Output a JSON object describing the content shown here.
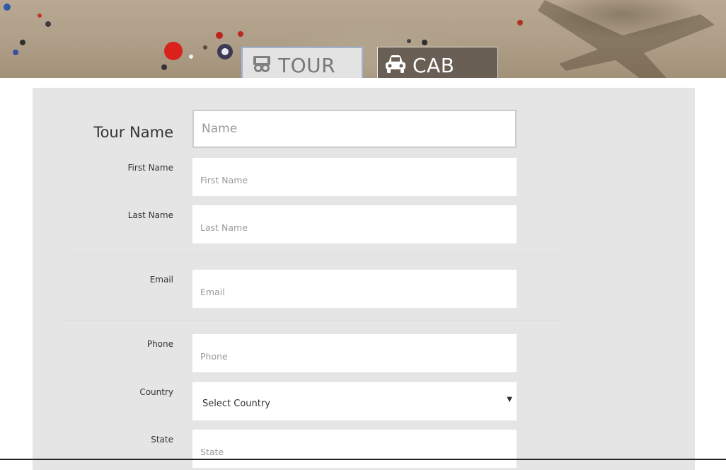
{
  "tabs": {
    "tour_label": "TOUR",
    "cab_label": "CAB"
  },
  "form": {
    "tour_name": {
      "label": "Tour Name",
      "placeholder": "Name"
    },
    "first_name": {
      "label": "First Name",
      "placeholder": "First Name"
    },
    "last_name": {
      "label": "Last Name",
      "placeholder": "Last Name"
    },
    "email": {
      "label": "Email",
      "placeholder": "Email"
    },
    "phone": {
      "label": "Phone",
      "placeholder": "Phone"
    },
    "country": {
      "label": "Country",
      "selected": "Select Country",
      "caret": "▼"
    },
    "state": {
      "label": "State",
      "placeholder": "State"
    }
  },
  "colors": {
    "card_bg": "#e5e5e5",
    "tab_tour_border": "#9db3d4",
    "tab_cab_bg": "#6a5f55"
  },
  "icons": {
    "tour": "binoculars-icon",
    "cab": "car-icon"
  }
}
